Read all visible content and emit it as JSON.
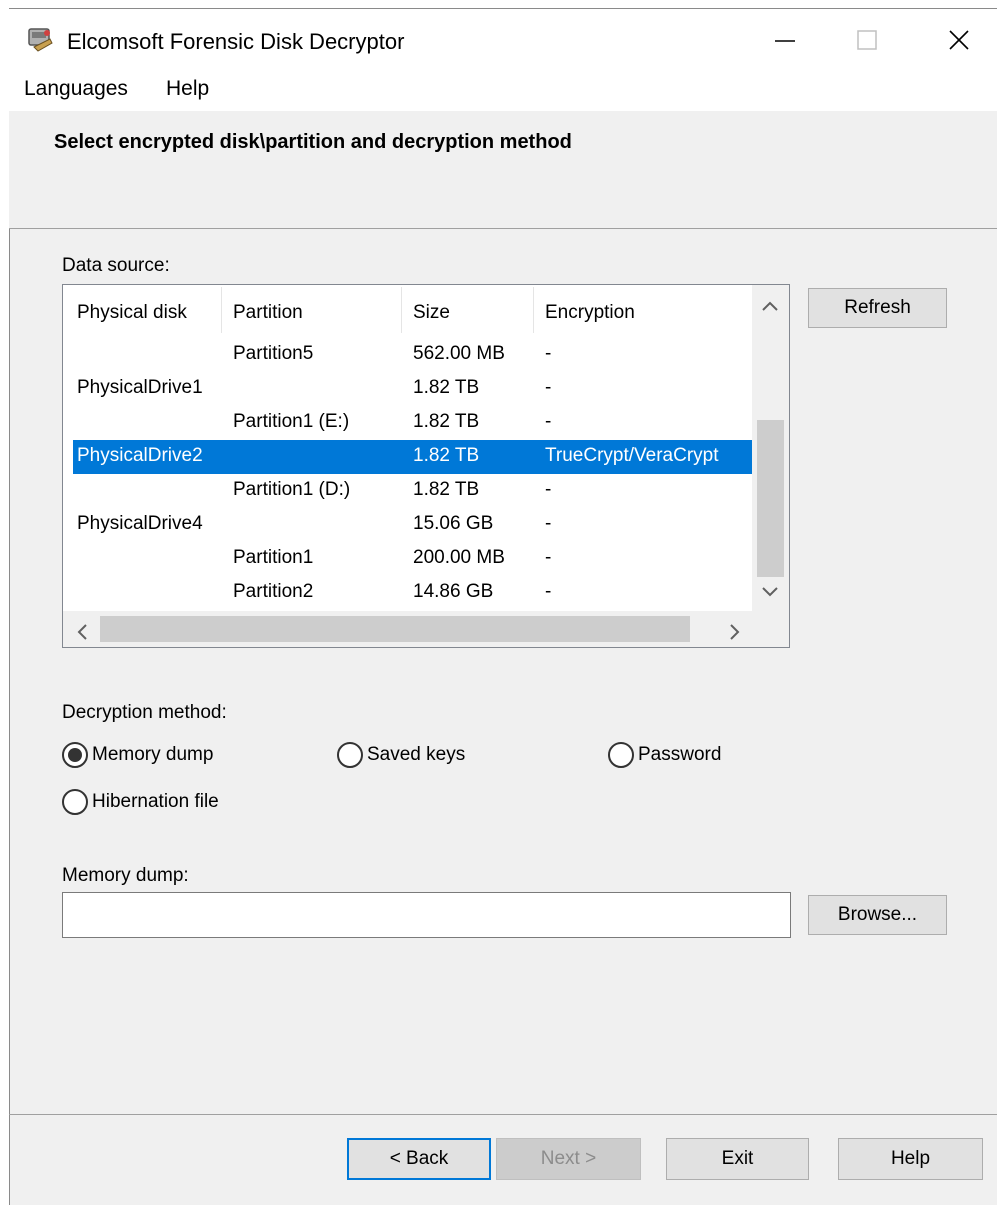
{
  "window": {
    "title": "Elcomsoft Forensic Disk Decryptor"
  },
  "menu": {
    "items": [
      "Languages",
      "Help"
    ]
  },
  "header": {
    "heading": "Select encrypted disk\\partition and decryption method"
  },
  "data_source": {
    "label": "Data source:",
    "refresh_label": "Refresh",
    "columns": [
      "Physical disk",
      "Partition",
      "Size",
      "Encryption"
    ],
    "rows": [
      {
        "disk": "",
        "partition": "Partition5",
        "size": "562.00 MB",
        "encryption": "-"
      },
      {
        "disk": "PhysicalDrive1",
        "partition": "",
        "size": "1.82 TB",
        "encryption": "-"
      },
      {
        "disk": "",
        "partition": "Partition1 (E:)",
        "size": "1.82 TB",
        "encryption": "-"
      },
      {
        "disk": "PhysicalDrive2",
        "partition": "",
        "size": "1.82 TB",
        "encryption": "TrueCrypt/VeraCrypt",
        "selected": true
      },
      {
        "disk": "",
        "partition": "Partition1 (D:)",
        "size": "1.82 TB",
        "encryption": "-"
      },
      {
        "disk": "PhysicalDrive4",
        "partition": "",
        "size": "15.06 GB",
        "encryption": "-"
      },
      {
        "disk": "",
        "partition": "Partition1",
        "size": "200.00 MB",
        "encryption": "-"
      },
      {
        "disk": "",
        "partition": "Partition2",
        "size": "14.86 GB",
        "encryption": "-"
      }
    ]
  },
  "decryption": {
    "label": "Decryption method:",
    "options": [
      "Memory dump",
      "Saved keys",
      "Password",
      "Hibernation file"
    ],
    "selected": "Memory dump"
  },
  "memory_dump": {
    "label": "Memory dump:",
    "value": "",
    "browse_label": "Browse..."
  },
  "footer": {
    "back_label": "< Back",
    "next_label": "Next >",
    "exit_label": "Exit",
    "help_label": "Help"
  },
  "colors": {
    "selection": "#0078d7",
    "window_bg": "#f0f0f0"
  }
}
